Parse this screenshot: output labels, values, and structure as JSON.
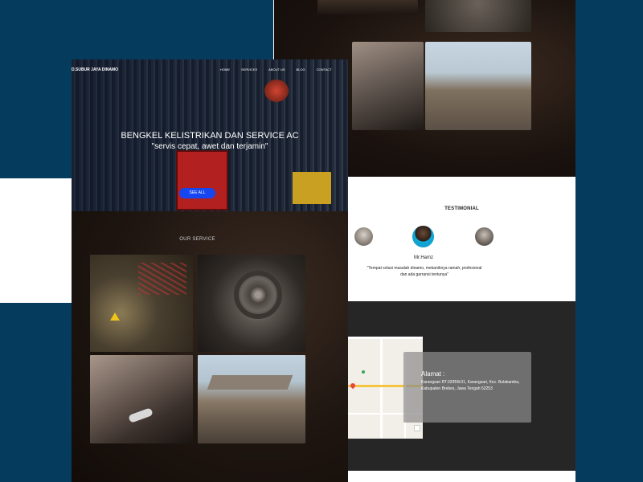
{
  "brand": "D.SUBUR JAYA DINAMO",
  "nav": {
    "items": [
      "HOME",
      "SERVICES",
      "ABOUT US",
      "BLOG",
      "CONTACT"
    ]
  },
  "hero": {
    "title": "BENGKEL KELISTRIKAN DAN SERVICE AC",
    "subtitle": "\"servis cepat, awet dan terjamin\"",
    "button": "SEE ALL"
  },
  "services": {
    "title": "OUR SERVICE"
  },
  "testimonial": {
    "title": "TESTIMONIAL",
    "name": "Mr.Hamz",
    "quote": "\"Tempat solusi masalah dinamo, mekaniknya ramah, profesional dan ada garransi tentunya\""
  },
  "contact": {
    "address_label": "Alamat :",
    "address": "Karangsari RT.02/RW.01, Karangsari, Kec. Bulakamba, Kabupaten Brebes, Jawa Tengah 52253"
  },
  "colors": {
    "navy": "#053b5c",
    "button_blue": "#1646f0",
    "dark_section": "#262626"
  }
}
